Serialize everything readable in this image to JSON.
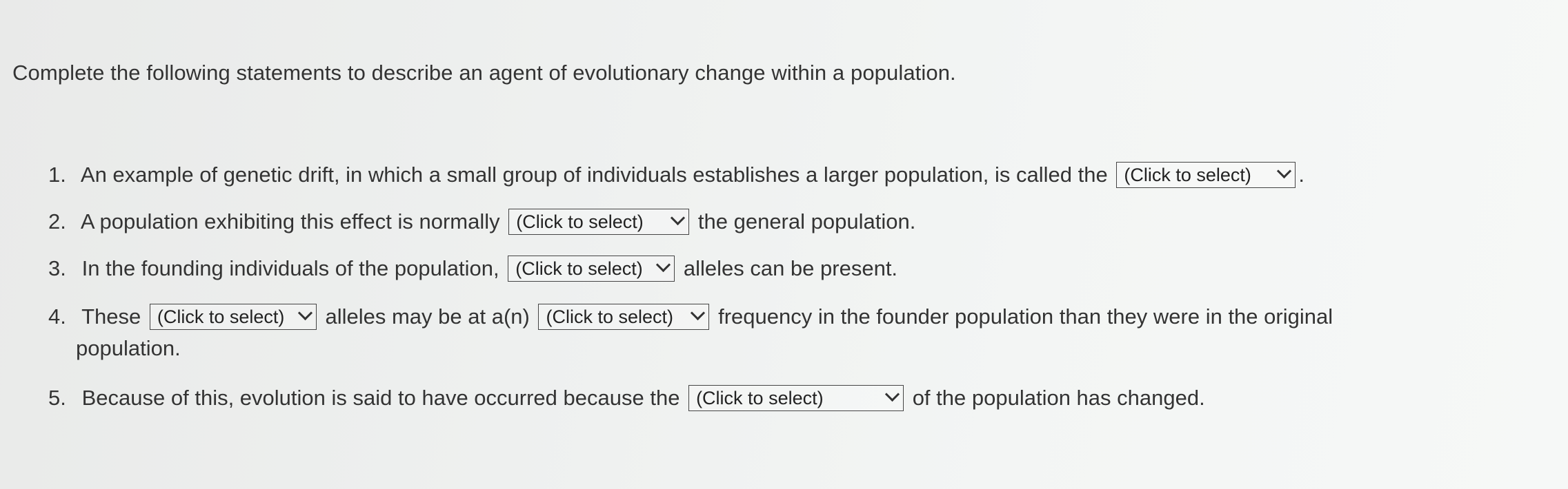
{
  "intro": "Complete the following statements to describe an agent of evolutionary change within a population.",
  "questions": {
    "q1": {
      "num": "1.",
      "before": "An example of genetic drift, in which a small group of individuals establishes a larger population, is called the",
      "select": "(Click to select)",
      "after": "."
    },
    "q2": {
      "num": "2.",
      "before": "A population exhibiting this effect is normally",
      "select": "(Click to select)",
      "after": "the general population."
    },
    "q3": {
      "num": "3.",
      "before": "In the founding individuals of the population,",
      "select": "(Click to select)",
      "after": "alleles can be present."
    },
    "q4": {
      "num": "4.",
      "before": "These",
      "select1": "(Click to select)",
      "middle": "alleles may be at a(n)",
      "select2": "(Click to select)",
      "after": "frequency in the founder population than they were in the original",
      "wrap": "population."
    },
    "q5": {
      "num": "5.",
      "before": "Because of this, evolution is said to have occurred because the",
      "select": "(Click to select)",
      "after": "of the population has changed."
    }
  }
}
